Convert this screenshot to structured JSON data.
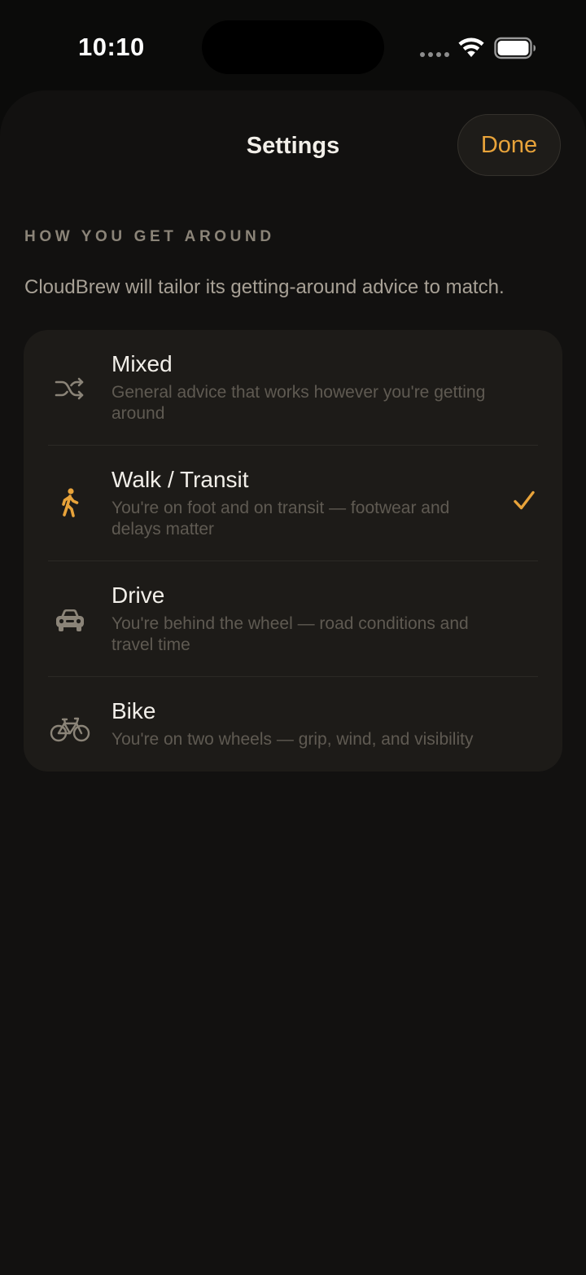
{
  "status_bar": {
    "time": "10:10"
  },
  "sheet": {
    "title": "Settings",
    "done_label": "Done",
    "section_header": "HOW YOU GET AROUND",
    "section_subtitle": "CloudBrew will tailor its getting-around advice to match."
  },
  "options": [
    {
      "title": "Mixed",
      "description": "General advice that works however you're getting around",
      "icon": "shuffle-icon",
      "selected": false
    },
    {
      "title": "Walk / Transit",
      "description": "You're on foot and on transit — footwear and delays matter",
      "icon": "walking-person-icon",
      "selected": true
    },
    {
      "title": "Drive",
      "description": "You're behind the wheel — road conditions and travel time",
      "icon": "car-icon",
      "selected": false
    },
    {
      "title": "Bike",
      "description": "You're on two wheels — grip, wind, and visibility",
      "icon": "bicycle-icon",
      "selected": false
    }
  ],
  "colors": {
    "accent": "#e8a33a",
    "sheet_background": "#121110",
    "card_background": "#1d1b18",
    "muted_icon": "#8b8478"
  }
}
